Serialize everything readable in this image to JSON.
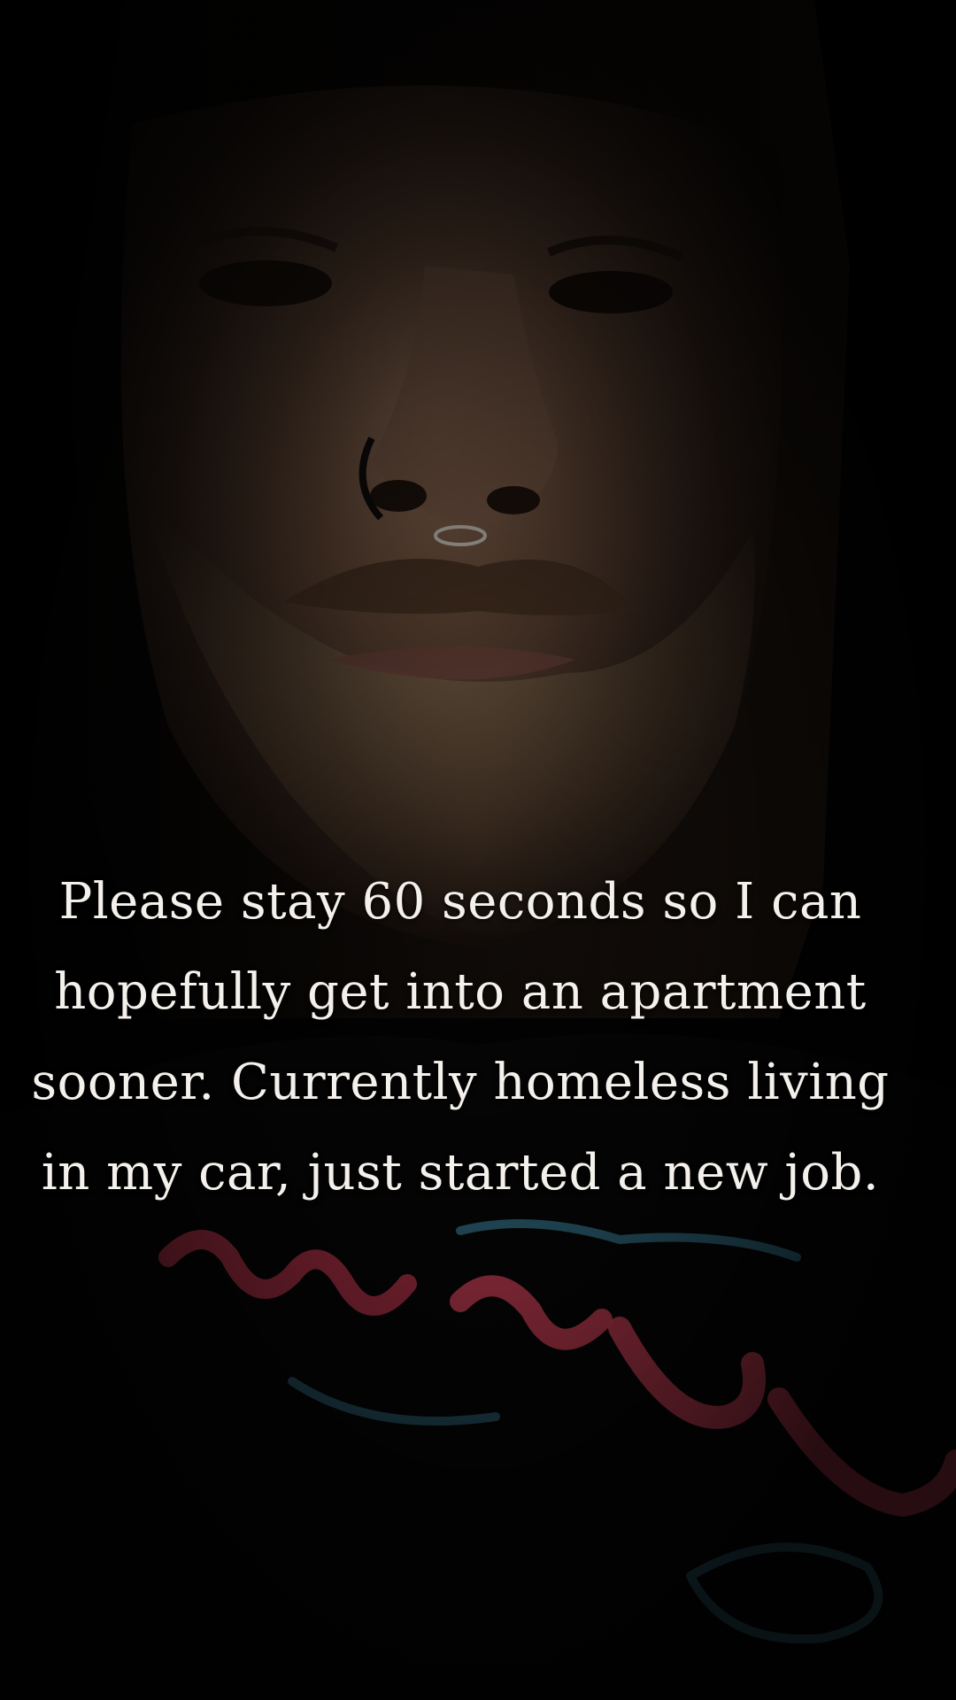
{
  "video": {
    "caption_lines": [
      "Please stay 60 seconds so I can",
      "hopefully get into an apartment",
      "sooner. Currently homeless living",
      "in my car, just started a new job."
    ]
  },
  "colors": {
    "background": "#000000",
    "caption_text": "#f4f1ec",
    "shirt_print_red": "#e0405a",
    "shirt_print_blue": "#4aa6c8"
  }
}
